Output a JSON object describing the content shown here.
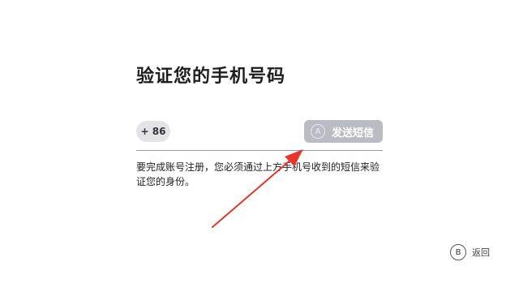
{
  "title": "验证您的手机号码",
  "phone": {
    "country_code": "+ 86"
  },
  "send_button": {
    "key_hint": "A",
    "label": "发送短信"
  },
  "description": "要完成账号注册，您必须通过上方手机号收到的短信来验证您的身份。",
  "footer": {
    "back_key": "B",
    "back_label": "返回"
  },
  "colors": {
    "send_button_bg": "#b9bcc2",
    "country_code_bg": "#e4e4e7",
    "annotation_arrow": "#e8352b"
  }
}
